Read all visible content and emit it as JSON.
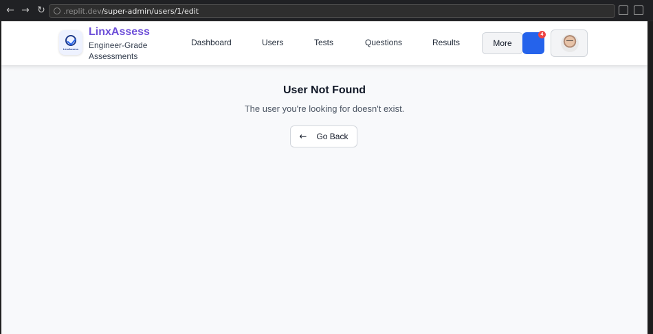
{
  "browser": {
    "url_host": ".replit.dev",
    "url_path": "/super-admin/users/1/edit",
    "icons": [
      "back-arrow-icon",
      "forward-arrow-icon",
      "reload-icon",
      "cast-icon",
      "open-external-icon"
    ]
  },
  "header": {
    "brand_name": "LinxAssess",
    "brand_tagline": "Engineer-Grade Assessments",
    "logo_mini_text": "LinxAssess",
    "nav": [
      "Dashboard",
      "Users",
      "Tests",
      "Questions",
      "Results"
    ],
    "more_label": "More",
    "notification_count": "4"
  },
  "main": {
    "title": "User Not Found",
    "message": "The user you're looking for doesn't exist.",
    "back_label": "Go Back"
  },
  "colors": {
    "brand": "#6d4fd8",
    "notification_button": "#2563eb",
    "badge": "#ef4444",
    "page_background": "#f8f9fb"
  }
}
